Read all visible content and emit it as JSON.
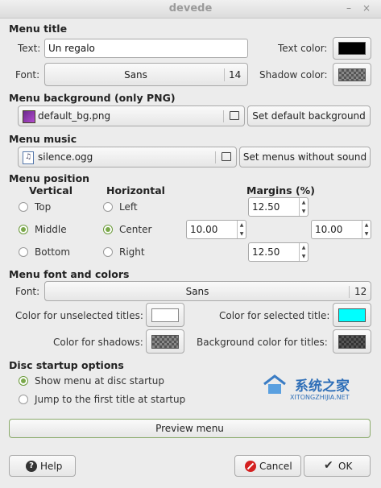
{
  "window": {
    "title": "devede",
    "minimize_glyph": "–",
    "close_glyph": "×"
  },
  "menu_title": {
    "heading": "Menu title",
    "text_label": "Text:",
    "text_value": "Un regalo",
    "text_color_label": "Text color:",
    "text_color": "#000000",
    "font_label": "Font:",
    "font_name": "Sans",
    "font_size": "14",
    "shadow_color_label": "Shadow color:"
  },
  "menu_background": {
    "heading": "Menu background (only PNG)",
    "file": "default_bg.png",
    "file_icon": "image-file-icon",
    "set_default_label": "Set default background"
  },
  "menu_music": {
    "heading": "Menu music",
    "file": "silence.ogg",
    "file_icon": "audio-file-icon",
    "no_sound_label": "Set menus without sound"
  },
  "menu_position": {
    "heading": "Menu position",
    "vertical_label": "Vertical",
    "horizontal_label": "Horizontal",
    "margins_label": "Margins (%)",
    "vertical": [
      "Top",
      "Middle",
      "Bottom"
    ],
    "vertical_selected": "Middle",
    "horizontal": [
      "Left",
      "Center",
      "Right"
    ],
    "horizontal_selected": "Center",
    "margin_top": "12.50",
    "margin_left": "10.00",
    "margin_right": "10.00",
    "margin_bottom": "12.50"
  },
  "menu_font": {
    "heading": "Menu font and colors",
    "font_label": "Font:",
    "font_name": "Sans",
    "font_size": "12",
    "unselected_label": "Color for unselected titles:",
    "unselected_color": "#ffffff",
    "selected_label": "Color for selected title:",
    "selected_color": "#00ffff",
    "shadows_label": "Color for shadows:",
    "bg_titles_label": "Background color for titles:"
  },
  "disc_startup": {
    "heading": "Disc startup options",
    "options": [
      "Show menu at disc startup",
      "Jump to the first title at startup"
    ],
    "selected": "Show menu at disc startup"
  },
  "preview_label": "Preview menu",
  "watermark": {
    "text": "系统之家",
    "sub": "XITONGZHIJIA.NET"
  },
  "buttons": {
    "help": "Help",
    "cancel": "Cancel",
    "ok": "OK"
  }
}
